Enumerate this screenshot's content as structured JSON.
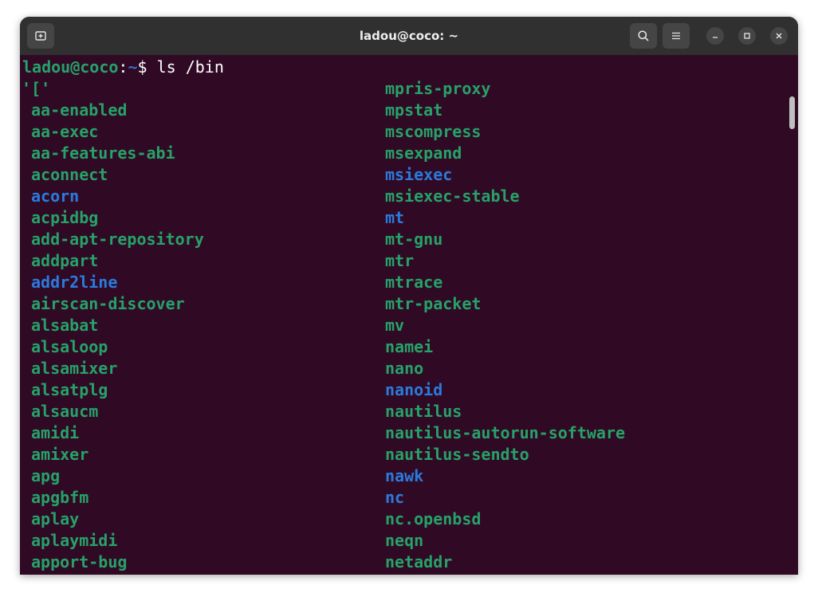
{
  "window": {
    "title": "ladou@coco: ~"
  },
  "colors": {
    "terminal_bg": "#300a24",
    "executable": "#26a269",
    "symlink": "#2a7bde",
    "prompt_user": "#26a269",
    "prompt_dir": "#3a6cc8",
    "titlebar": "#303030"
  },
  "icons": {
    "new_tab": "new-tab-icon",
    "search": "search-icon",
    "menu": "hamburger-menu-icon",
    "minimize": "minimize-icon",
    "maximize": "maximize-icon",
    "close": "close-icon"
  },
  "terminal": {
    "prompt_user_host": "ladou@coco",
    "prompt_colon": ":",
    "prompt_dir": "~",
    "prompt_symbol": "$",
    "command": " ls /bin",
    "left_column": [
      {
        "name": "'['",
        "type": "executable"
      },
      {
        "name": "aa-enabled",
        "type": "executable"
      },
      {
        "name": "aa-exec",
        "type": "executable"
      },
      {
        "name": "aa-features-abi",
        "type": "executable"
      },
      {
        "name": "aconnect",
        "type": "executable"
      },
      {
        "name": "acorn",
        "type": "symlink"
      },
      {
        "name": "acpidbg",
        "type": "executable"
      },
      {
        "name": "add-apt-repository",
        "type": "executable"
      },
      {
        "name": "addpart",
        "type": "executable"
      },
      {
        "name": "addr2line",
        "type": "symlink"
      },
      {
        "name": "airscan-discover",
        "type": "executable"
      },
      {
        "name": "alsabat",
        "type": "executable"
      },
      {
        "name": "alsaloop",
        "type": "executable"
      },
      {
        "name": "alsamixer",
        "type": "executable"
      },
      {
        "name": "alsatplg",
        "type": "executable"
      },
      {
        "name": "alsaucm",
        "type": "executable"
      },
      {
        "name": "amidi",
        "type": "executable"
      },
      {
        "name": "amixer",
        "type": "executable"
      },
      {
        "name": "apg",
        "type": "executable"
      },
      {
        "name": "apgbfm",
        "type": "executable"
      },
      {
        "name": "aplay",
        "type": "executable"
      },
      {
        "name": "aplaymidi",
        "type": "executable"
      },
      {
        "name": "apport-bug",
        "type": "executable"
      }
    ],
    "right_column": [
      {
        "name": "mpris-proxy",
        "type": "executable"
      },
      {
        "name": "mpstat",
        "type": "executable"
      },
      {
        "name": "mscompress",
        "type": "executable"
      },
      {
        "name": "msexpand",
        "type": "executable"
      },
      {
        "name": "msiexec",
        "type": "symlink"
      },
      {
        "name": "msiexec-stable",
        "type": "executable"
      },
      {
        "name": "mt",
        "type": "symlink"
      },
      {
        "name": "mt-gnu",
        "type": "executable"
      },
      {
        "name": "mtr",
        "type": "executable"
      },
      {
        "name": "mtrace",
        "type": "executable"
      },
      {
        "name": "mtr-packet",
        "type": "executable"
      },
      {
        "name": "mv",
        "type": "executable"
      },
      {
        "name": "namei",
        "type": "executable"
      },
      {
        "name": "nano",
        "type": "executable"
      },
      {
        "name": "nanoid",
        "type": "symlink"
      },
      {
        "name": "nautilus",
        "type": "executable"
      },
      {
        "name": "nautilus-autorun-software",
        "type": "executable"
      },
      {
        "name": "nautilus-sendto",
        "type": "executable"
      },
      {
        "name": "nawk",
        "type": "symlink"
      },
      {
        "name": "nc",
        "type": "symlink"
      },
      {
        "name": "nc.openbsd",
        "type": "executable"
      },
      {
        "name": "neqn",
        "type": "executable"
      },
      {
        "name": "netaddr",
        "type": "executable"
      }
    ]
  }
}
